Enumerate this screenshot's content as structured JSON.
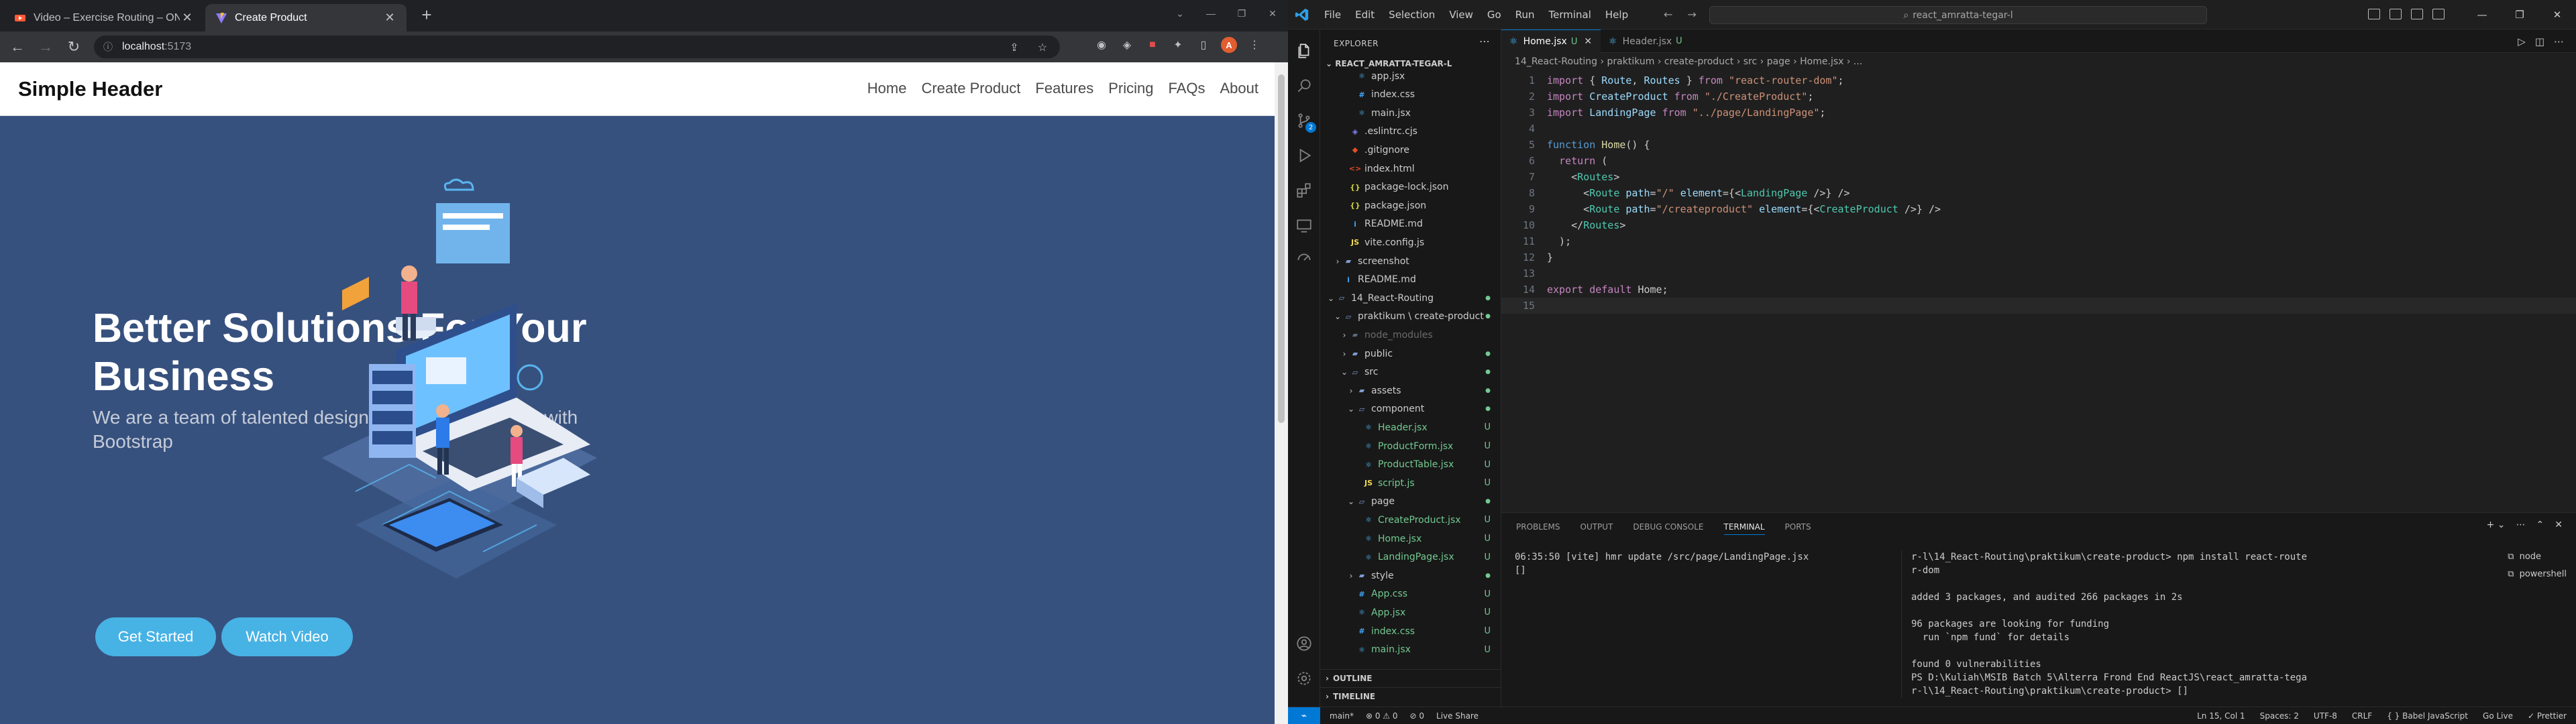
{
  "browser": {
    "tabs": [
      {
        "title": "Video – Exercise Routing – ON",
        "active": false
      },
      {
        "title": "Create Product",
        "active": true
      }
    ],
    "url_host": "localhost",
    "url_port": ":5173",
    "profile_initial": "A"
  },
  "site": {
    "brand": "Simple Header",
    "nav": [
      "Home",
      "Create Product",
      "Features",
      "Pricing",
      "FAQs",
      "About"
    ],
    "hero_title": "Better Solutions For Your Business",
    "hero_subtitle": "We are a team of talented designers making websites with Bootstrap",
    "btn_primary": "Get Started",
    "btn_secondary": "Watch Video",
    "colors": {
      "hero_bg": "#37517e",
      "accent": "#47b2e4"
    }
  },
  "vscode": {
    "menus": [
      "File",
      "Edit",
      "Selection",
      "View",
      "Go",
      "Run",
      "Terminal",
      "Help"
    ],
    "search": "react_amratta-tegar-l",
    "explorer_title": "EXPLORER",
    "project": "REACT_AMRATTA-TEGAR-L",
    "scm_badge": "2",
    "tree": [
      {
        "name": "app.jsx",
        "depth": 3,
        "type": "react",
        "dec": ""
      },
      {
        "name": "index.css",
        "depth": 3,
        "type": "css",
        "dec": ""
      },
      {
        "name": "main.jsx",
        "depth": 3,
        "type": "react",
        "dec": ""
      },
      {
        "name": ".eslintrc.cjs",
        "depth": 2,
        "type": "eslint",
        "dec": ""
      },
      {
        "name": ".gitignore",
        "depth": 2,
        "type": "git",
        "dec": ""
      },
      {
        "name": "index.html",
        "depth": 2,
        "type": "html",
        "dec": ""
      },
      {
        "name": "package-lock.json",
        "depth": 2,
        "type": "json",
        "dec": ""
      },
      {
        "name": "package.json",
        "depth": 2,
        "type": "json",
        "dec": ""
      },
      {
        "name": "README.md",
        "depth": 2,
        "type": "md",
        "dec": ""
      },
      {
        "name": "vite.config.js",
        "depth": 2,
        "type": "js",
        "dec": ""
      },
      {
        "name": "screenshot",
        "depth": 1,
        "type": "folder",
        "dec": ""
      },
      {
        "name": "README.md",
        "depth": 1,
        "type": "md",
        "dec": ""
      },
      {
        "name": "14_React-Routing",
        "depth": 0,
        "type": "folder-open",
        "dec": "dot"
      },
      {
        "name": "praktikum \\ create-product",
        "depth": 1,
        "type": "folder-open",
        "dec": "dot"
      },
      {
        "name": "node_modules",
        "depth": 2,
        "type": "folder-dim",
        "dec": ""
      },
      {
        "name": "public",
        "depth": 2,
        "type": "folder",
        "dec": "dot"
      },
      {
        "name": "src",
        "depth": 2,
        "type": "folder-open",
        "dec": "dot"
      },
      {
        "name": "assets",
        "depth": 3,
        "type": "folder",
        "dec": "dot"
      },
      {
        "name": "component",
        "depth": 3,
        "type": "folder-open",
        "dec": "dot"
      },
      {
        "name": "Header.jsx",
        "depth": 4,
        "type": "react",
        "dec": "U"
      },
      {
        "name": "ProductForm.jsx",
        "depth": 4,
        "type": "react",
        "dec": "U"
      },
      {
        "name": "ProductTable.jsx",
        "depth": 4,
        "type": "react",
        "dec": "U"
      },
      {
        "name": "script.js",
        "depth": 4,
        "type": "js",
        "dec": "U"
      },
      {
        "name": "page",
        "depth": 3,
        "type": "folder-open",
        "dec": "dot"
      },
      {
        "name": "CreateProduct.jsx",
        "depth": 4,
        "type": "react",
        "dec": "U"
      },
      {
        "name": "Home.jsx",
        "depth": 4,
        "type": "react",
        "dec": "U"
      },
      {
        "name": "LandingPage.jsx",
        "depth": 4,
        "type": "react",
        "dec": "U"
      },
      {
        "name": "style",
        "depth": 3,
        "type": "folder",
        "dec": "dot"
      },
      {
        "name": "App.css",
        "depth": 3,
        "type": "css",
        "dec": "U"
      },
      {
        "name": "App.jsx",
        "depth": 3,
        "type": "react",
        "dec": "U"
      },
      {
        "name": "index.css",
        "depth": 3,
        "type": "css",
        "dec": "U"
      },
      {
        "name": "main.jsx",
        "depth": 3,
        "type": "react",
        "dec": "U"
      }
    ],
    "outline": "OUTLINE",
    "timeline": "TIMELINE",
    "tabs": [
      {
        "name": "Home.jsx",
        "dec": "U",
        "active": true
      },
      {
        "name": "Header.jsx",
        "dec": "U",
        "active": false
      }
    ],
    "breadcrumb": "14_React-Routing  ›  praktikum  ›  create-product  ›  src  ›  page  ›  Home.jsx  ›  ...",
    "code": [
      "import { Route, Routes } from \"react-router-dom\";",
      "import CreateProduct from \"./CreateProduct\";",
      "import LandingPage from \"../page/LandingPage\";",
      "",
      "function Home() {",
      "  return (",
      "    <Routes>",
      "      <Route path=\"/\" element={<LandingPage />} />",
      "      <Route path=\"/createproduct\" element={<CreateProduct />} />",
      "    </Routes>",
      "  );",
      "}",
      "",
      "export default Home;",
      ""
    ],
    "panel_tabs": [
      "PROBLEMS",
      "OUTPUT",
      "DEBUG CONSOLE",
      "TERMINAL",
      "PORTS"
    ],
    "active_panel": "TERMINAL",
    "term_left": "06:35:50 [vite] hmr update /src/page/LandingPage.jsx\n[]",
    "term_right": "r-l\\14_React-Routing\\praktikum\\create-product> npm install react-route\nr-dom\n\nadded 3 packages, and audited 266 packages in 2s\n\n96 packages are looking for funding\n  run `npm fund` for details\n\nfound 0 vulnerabilities\nPS D:\\Kuliah\\MSIB Batch 5\\Alterra Frond End ReactJS\\react_amratta-tega\nr-l\\14_React-Routing\\praktikum\\create-product> []",
    "terminals": [
      "node",
      "powershell"
    ],
    "status_left": [
      "main*",
      "⊗ 0 ⚠ 0",
      "⊘ 0",
      "Live Share"
    ],
    "status_right": [
      "Ln 15, Col 1",
      "Spaces: 2",
      "UTF-8",
      "CRLF",
      "{ } Babel JavaScript",
      "Go Live",
      "✓ Prettier"
    ]
  }
}
